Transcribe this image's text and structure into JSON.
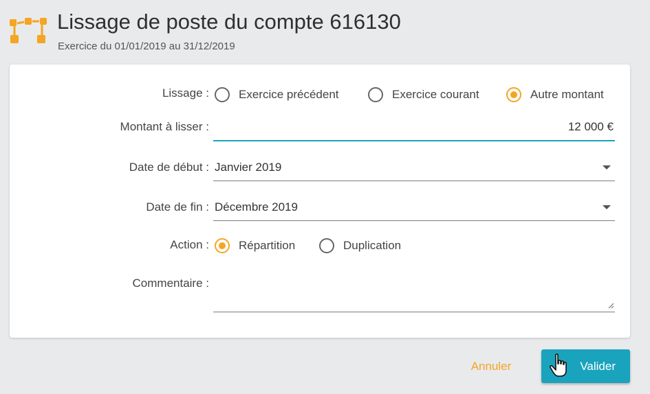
{
  "header": {
    "title": "Lissage de poste du compte 616130",
    "subtitle": "Exercice du 01/01/2019 au 31/12/2019",
    "logo_icon": "orange-hierarchy-icon"
  },
  "form": {
    "lissage": {
      "label": "Lissage :",
      "options": [
        "Exercice précédent",
        "Exercice courant",
        "Autre montant"
      ],
      "selected": "Autre montant"
    },
    "montant": {
      "label": "Montant à lisser :",
      "value": "12 000 €"
    },
    "date_debut": {
      "label": "Date de début :",
      "value": "Janvier 2019"
    },
    "date_fin": {
      "label": "Date de fin :",
      "value": "Décembre 2019"
    },
    "action": {
      "label": "Action :",
      "options": [
        "Répartition",
        "Duplication"
      ],
      "selected": "Répartition"
    },
    "commentaire": {
      "label": "Commentaire :",
      "value": ""
    }
  },
  "buttons": {
    "cancel": "Annuler",
    "ok": "Valider"
  },
  "colors": {
    "accent": "#f4a522",
    "primary": "#1aa3bc"
  }
}
